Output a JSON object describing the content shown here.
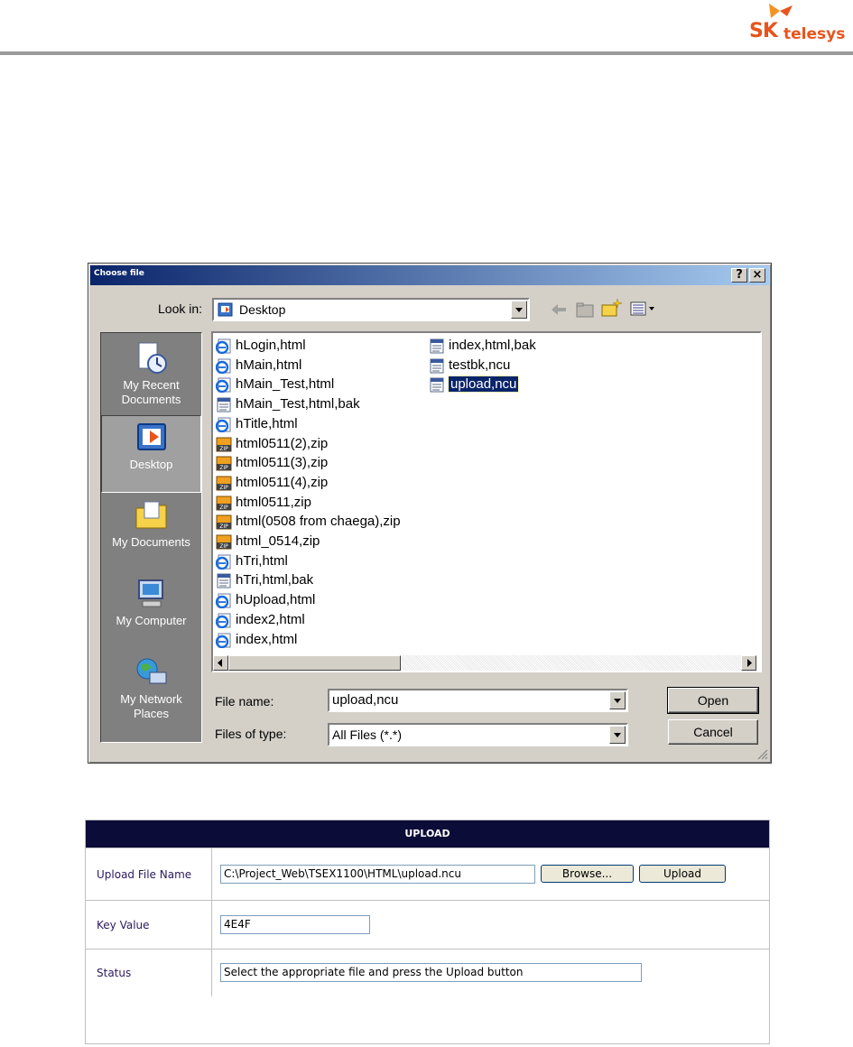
{
  "brand": {
    "logo_text_sk": "SK",
    "logo_text_telesys": "telesys"
  },
  "dialog": {
    "title": "Choose file",
    "help_button": "?",
    "close_button": "×",
    "look_in_label": "Look in:",
    "look_in_value": "Desktop",
    "places": [
      {
        "label": "My Recent Documents",
        "icon": "recent-documents-icon"
      },
      {
        "label": "Desktop",
        "icon": "desktop-icon",
        "selected": true
      },
      {
        "label": "My Documents",
        "icon": "my-documents-icon"
      },
      {
        "label": "My Computer",
        "icon": "my-computer-icon"
      },
      {
        "label": "My Network Places",
        "icon": "network-places-icon"
      }
    ],
    "files_col1": [
      {
        "name": "hLogin,html",
        "type": "html"
      },
      {
        "name": "hMain,html",
        "type": "html"
      },
      {
        "name": "hMain_Test,html",
        "type": "html"
      },
      {
        "name": "hMain_Test,html,bak",
        "type": "bak"
      },
      {
        "name": "hTitle,html",
        "type": "html"
      },
      {
        "name": "html0511(2),zip",
        "type": "zip"
      },
      {
        "name": "html0511(3),zip",
        "type": "zip"
      },
      {
        "name": "html0511(4),zip",
        "type": "zip"
      },
      {
        "name": "html0511,zip",
        "type": "zip"
      },
      {
        "name": "html(0508 from chaega),zip",
        "type": "zip"
      },
      {
        "name": "html_0514,zip",
        "type": "zip"
      },
      {
        "name": "hTri,html",
        "type": "html"
      },
      {
        "name": "hTri,html,bak",
        "type": "bak"
      },
      {
        "name": "hUpload,html",
        "type": "html"
      },
      {
        "name": "index2,html",
        "type": "html"
      },
      {
        "name": "index,html",
        "type": "html"
      }
    ],
    "files_col2": [
      {
        "name": "index,html,bak",
        "type": "bak"
      },
      {
        "name": "testbk,ncu",
        "type": "bak"
      },
      {
        "name": "upload,ncu",
        "type": "bak",
        "selected": true
      }
    ],
    "file_name_label": "File name:",
    "file_name_value": "upload,ncu",
    "files_of_type_label": "Files of type:",
    "files_of_type_value": "All Files (*.*)",
    "open_button": "Open",
    "cancel_button": "Cancel"
  },
  "upload": {
    "header": "UPLOAD",
    "rows": {
      "file_name_label": "Upload File Name",
      "file_path_value": "C:\\Project_Web\\TSEX1100\\HTML\\upload.ncu",
      "browse_button": "Browse...",
      "upload_button": "Upload",
      "key_label": "Key Value",
      "key_value": "4E4F",
      "status_label": "Status",
      "status_value": "Select the appropriate file and press the Upload button"
    }
  },
  "colors": {
    "accent_orange": "#e8541c",
    "dialog_face": "#d4d0c8",
    "selection": "#0a246a",
    "upload_header": "#0c0c38"
  }
}
